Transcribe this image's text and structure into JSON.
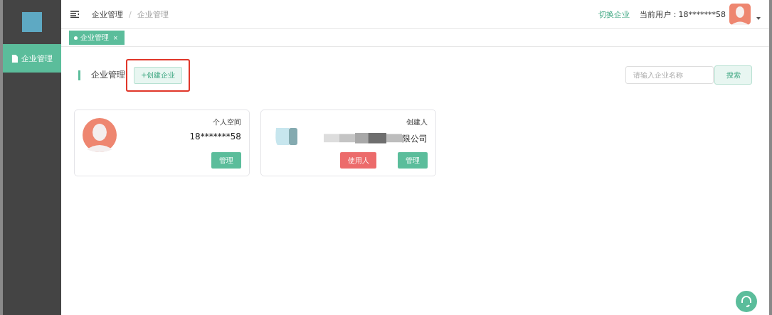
{
  "sidebar": {
    "items": [
      {
        "label": "企业管理",
        "selected": true
      }
    ]
  },
  "header": {
    "breadcrumb": [
      "企业管理",
      "企业管理"
    ],
    "separator": "/",
    "switch_link": "切换企业",
    "user_label": "当前用户：",
    "user_name": "18*******58"
  },
  "tags": [
    {
      "label": "企业管理",
      "selected": true,
      "close": "×"
    }
  ],
  "page": {
    "title": "企业管理",
    "create_button": "+创建企业",
    "search": {
      "placeholder": "请输入企业名称"
    },
    "search_button": "搜索"
  },
  "cards": [
    {
      "kind": "personal",
      "top": "个人空间",
      "name": "18*******58",
      "buttons": [
        {
          "label": "管理",
          "kind": "primary"
        }
      ]
    },
    {
      "kind": "company",
      "top": "创建人",
      "name": "限公司",
      "buttons": [
        {
          "label": "使用人",
          "kind": "danger"
        },
        {
          "label": "管理",
          "kind": "primary"
        }
      ]
    }
  ]
}
